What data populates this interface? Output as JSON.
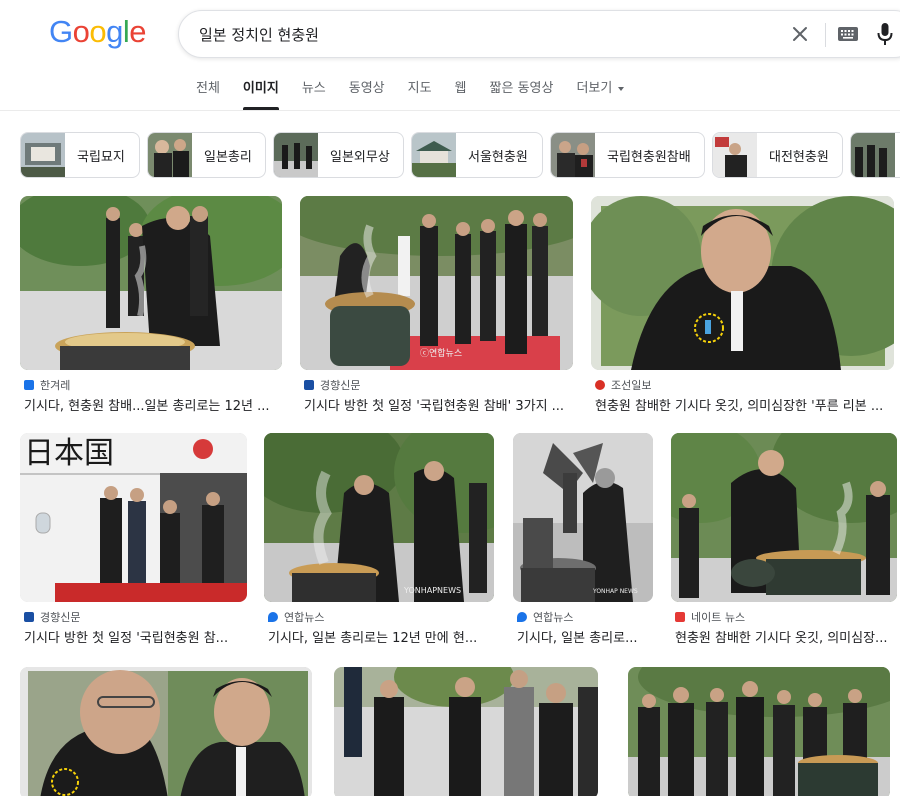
{
  "logo": {
    "letters": [
      "G",
      "o",
      "o",
      "g",
      "l",
      "e"
    ],
    "colors": [
      "#4285f4",
      "#ea4335",
      "#fbbc05",
      "#4285f4",
      "#34a853",
      "#ea4335"
    ]
  },
  "search": {
    "query": "일본 정치인 현충원",
    "clear_icon": "close-icon",
    "keyboard_icon": "keyboard-icon",
    "mic_icon": "mic-icon"
  },
  "tabs": [
    "전체",
    "이미지",
    "뉴스",
    "동영상",
    "지도",
    "웹",
    "짧은 동영상",
    "더보기"
  ],
  "active_tab": "이미지",
  "chips": [
    "국립묘지",
    "일본총리",
    "일본외무상",
    "서울현충원",
    "국립현충원참배",
    "대전현충원",
    ""
  ],
  "results": [
    {
      "source": "한겨레",
      "source_color": "#1a73e8",
      "title": "기시다, 현충원 참배...일본 총리로는 12년 ..."
    },
    {
      "source": "경향신문",
      "source_color": "#1a4fa3",
      "title": "기시다 방한 첫 일정 '국립현충원 참배' 3가지 ..."
    },
    {
      "source": "조선일보",
      "source_color": "#d93025",
      "title": "현충원 참배한 기시다 옷깃, 의미심장한 '푸른 리본 ..."
    },
    {
      "source": "경향신문",
      "source_color": "#1a4fa3",
      "title": "기시다 방한 첫 일정 '국립현충원 참..."
    },
    {
      "source": "연합뉴스",
      "source_color": "#1a73e8",
      "title": "기시다, 일본 총리로는 12년 만에 현..."
    },
    {
      "source": "연합뉴스",
      "source_color": "#1a73e8",
      "title": "기시다, 일본 총리로..."
    },
    {
      "source": "네이트 뉴스",
      "source_color": "#e53935",
      "title": "현충원 참배한 기시다 옷깃, 의미심장..."
    },
    {
      "source": "",
      "source_color": "",
      "title": ""
    },
    {
      "source": "",
      "source_color": "",
      "title": ""
    },
    {
      "source": "",
      "source_color": "",
      "title": ""
    }
  ],
  "watermarks": {
    "r2": "ⓒ연합뉴스",
    "r5": "YONHAPNEWS",
    "r6": "YONHAP NEWS"
  },
  "jet_text": "日本国"
}
